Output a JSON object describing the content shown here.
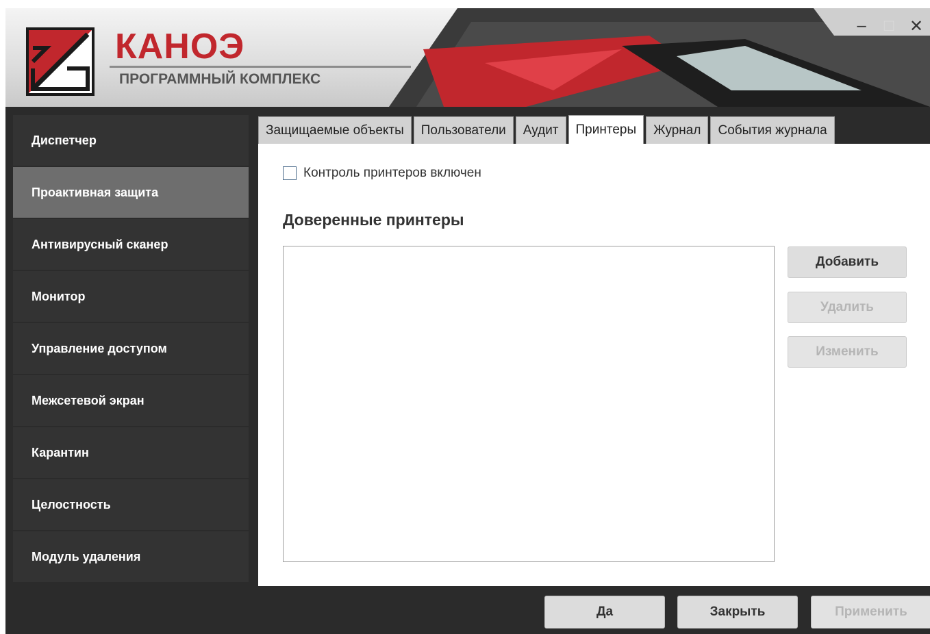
{
  "window": {
    "brand_title": "КАНОЭ",
    "brand_subtitle": "ПРОГРАММНЫЙ КОМПЛЕКС",
    "controls": {
      "minimize": "–",
      "maximize": "□",
      "close": "✕"
    }
  },
  "sidebar": {
    "items": [
      {
        "label": "Диспетчер",
        "active": false
      },
      {
        "label": "Проактивная защита",
        "active": true
      },
      {
        "label": "Антивирусный сканер",
        "active": false
      },
      {
        "label": "Монитор",
        "active": false
      },
      {
        "label": "Управление доступом",
        "active": false
      },
      {
        "label": "Межсетевой экран",
        "active": false
      },
      {
        "label": "Карантин",
        "active": false
      },
      {
        "label": "Целостность",
        "active": false
      },
      {
        "label": "Модуль удаления",
        "active": false
      }
    ]
  },
  "tabs": [
    {
      "label": "Защищаемые объекты",
      "active": false
    },
    {
      "label": "Пользователи",
      "active": false
    },
    {
      "label": "Аудит",
      "active": false
    },
    {
      "label": "Принтеры",
      "active": true
    },
    {
      "label": "Журнал",
      "active": false
    },
    {
      "label": "События журнала",
      "active": false
    }
  ],
  "printers": {
    "checkbox_label": "Контроль принтеров включен",
    "checkbox_checked": false,
    "section_title": "Доверенные принтеры",
    "trusted_printers": [],
    "buttons": {
      "add": "Добавить",
      "remove": "Удалить",
      "edit": "Изменить"
    }
  },
  "footer": {
    "ok": "Да",
    "close": "Закрыть",
    "apply": "Применить"
  },
  "colors": {
    "brand_red": "#c1272d",
    "sidebar_bg": "#333333",
    "sidebar_active": "#6e6e6e",
    "window_bg": "#2b2b2b"
  }
}
